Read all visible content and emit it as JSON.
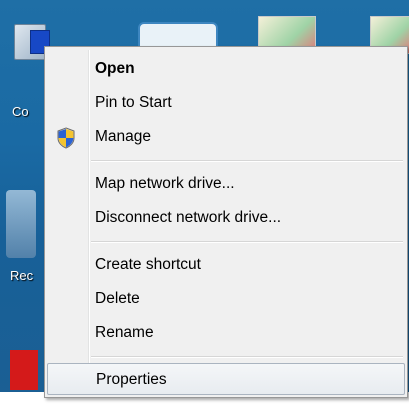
{
  "desktop": {
    "computer_label": "Co",
    "recycle_label": "Rec"
  },
  "context_menu": {
    "items": [
      {
        "label": "Open",
        "bold": true
      },
      {
        "label": "Pin to Start"
      },
      {
        "label": "Manage",
        "icon": "uac-shield-icon"
      },
      {
        "label": "Map network drive..."
      },
      {
        "label": "Disconnect network drive..."
      },
      {
        "label": "Create shortcut"
      },
      {
        "label": "Delete"
      },
      {
        "label": "Rename"
      },
      {
        "label": "Properties",
        "highlighted": true
      }
    ]
  },
  "colors": {
    "desktop_blue": "#1a6aa4",
    "menu_background": "#f0f0f0",
    "highlight_border": "#aab4c0"
  }
}
